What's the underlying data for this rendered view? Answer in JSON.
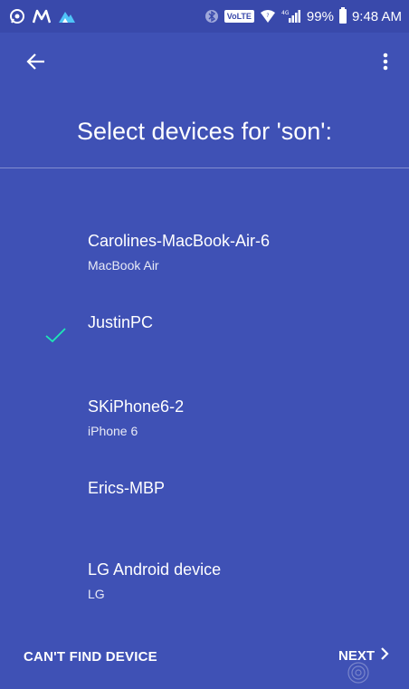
{
  "status_bar": {
    "left_icons": [
      "whatsapp-icon",
      "m-app-icon",
      "mountain-app-icon"
    ],
    "battery": "99%",
    "time": "9:48 AM",
    "volte_label": "VoLTE",
    "network_label": "4G"
  },
  "toolbar": {
    "back_icon": "arrow-left-icon",
    "menu_icon": "more-vert-icon"
  },
  "title": "Select devices for 'son':",
  "devices": [
    {
      "name": "Carolines-MacBook-Air-6",
      "type": "MacBook Air",
      "selected": false
    },
    {
      "name": "JustinPC",
      "type": "",
      "selected": true
    },
    {
      "name": "SKiPhone6-2",
      "type": "iPhone 6",
      "selected": false
    },
    {
      "name": "Erics-MBP",
      "type": "",
      "selected": false
    },
    {
      "name": "LG Android device",
      "type": "LG",
      "selected": false
    }
  ],
  "footer": {
    "cant_find_label": "CAN'T FIND DEVICE",
    "next_label": "NEXT"
  },
  "colors": {
    "background": "#3f51b5",
    "status_bar": "#3949ab",
    "check": "#1de9b6"
  }
}
